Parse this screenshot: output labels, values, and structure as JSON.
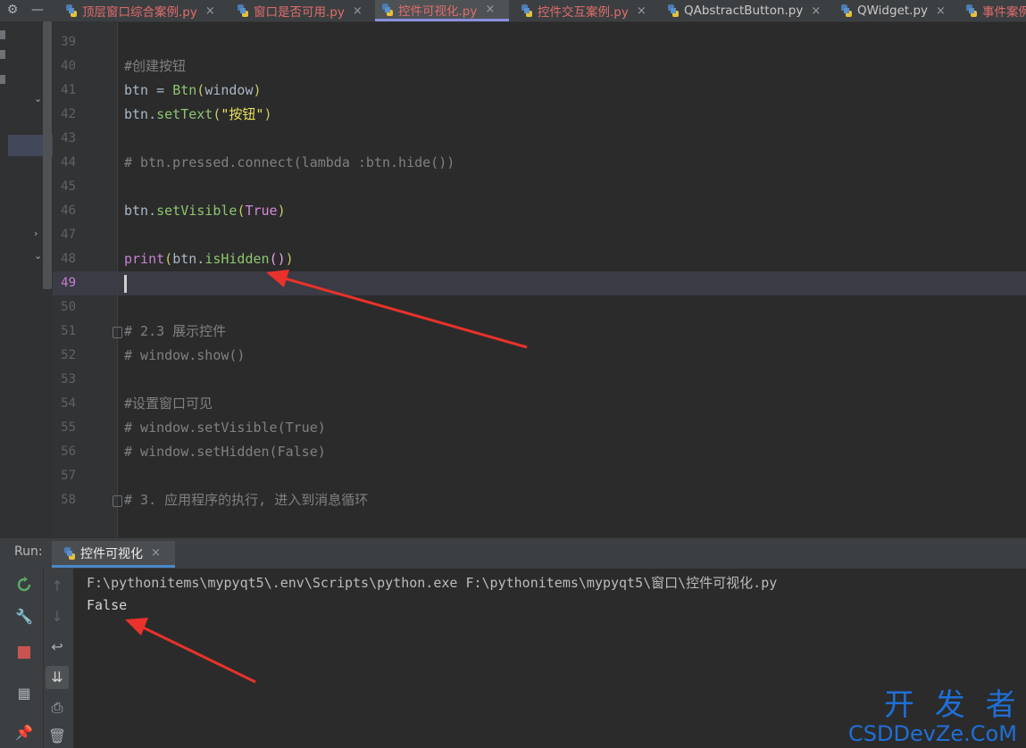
{
  "tabs": [
    {
      "label": "顶层窗口综合案例.py",
      "color": "#e06c6c"
    },
    {
      "label": "窗口是否可用.py",
      "color": "#e06c6c"
    },
    {
      "label": "控件可视化.py",
      "color": "#e06c6c"
    },
    {
      "label": "控件交互案例.py",
      "color": "#e06c6c"
    },
    {
      "label": "QAbstractButton.py",
      "color": "#c9c9c9"
    },
    {
      "label": "QWidget.py",
      "color": "#c9c9c9"
    },
    {
      "label": "事件案例",
      "color": "#e06c6c"
    }
  ],
  "tab_close": "×",
  "toolbar": {
    "settings_glyph": "⚙",
    "minimize_glyph": "—"
  },
  "editor": {
    "line_numbers": [
      "39",
      "40",
      "41",
      "42",
      "43",
      "44",
      "45",
      "46",
      "47",
      "48",
      "49",
      "50",
      "51",
      "52",
      "53",
      "54",
      "55",
      "56",
      "57",
      "58"
    ],
    "code": {
      "l40": "#创建按钮",
      "l41_a": "btn = ",
      "l41_b": "Btn",
      "l41_c": "(",
      "l41_d": "window",
      "l41_e": ")",
      "l42_a": "btn.",
      "l42_b": "setText",
      "l42_c": "(",
      "l42_d": "\"按钮\"",
      "l42_e": ")",
      "l44": "# btn.pressed.connect(lambda :btn.hide())",
      "l46_a": "btn.",
      "l46_b": "setVisible",
      "l46_c": "(",
      "l46_d": "True",
      "l46_e": ")",
      "l48_a": "print",
      "l48_b": "(",
      "l48_c": "btn.",
      "l48_d": "isHidden",
      "l48_e": "()",
      "l48_f": ")",
      "l51": "# 2.3 展示控件",
      "l52": "# window.show()",
      "l54": "#设置窗口可见",
      "l55": "# window.setVisible(True)",
      "l56": "# window.setHidden(False)",
      "l58": "# 3. 应用程序的执行, 进入到消息循环"
    }
  },
  "run": {
    "label": "Run:",
    "tab_label": "控件可视化",
    "command": "F:\\pythonitems\\mypyqt5\\.env\\Scripts\\python.exe F:\\pythonitems\\mypyqt5\\窗口\\控件可视化.py",
    "output": "False"
  },
  "watermark": {
    "top": "开 发 者",
    "bottom": "CSDDevZe.CoM"
  },
  "colors": {
    "arrow": "#e8322a",
    "accent_tab": "#8a8fe0",
    "run_icon": "#59a869",
    "stop": "#c75450",
    "watermark": "#1f6fd6"
  }
}
